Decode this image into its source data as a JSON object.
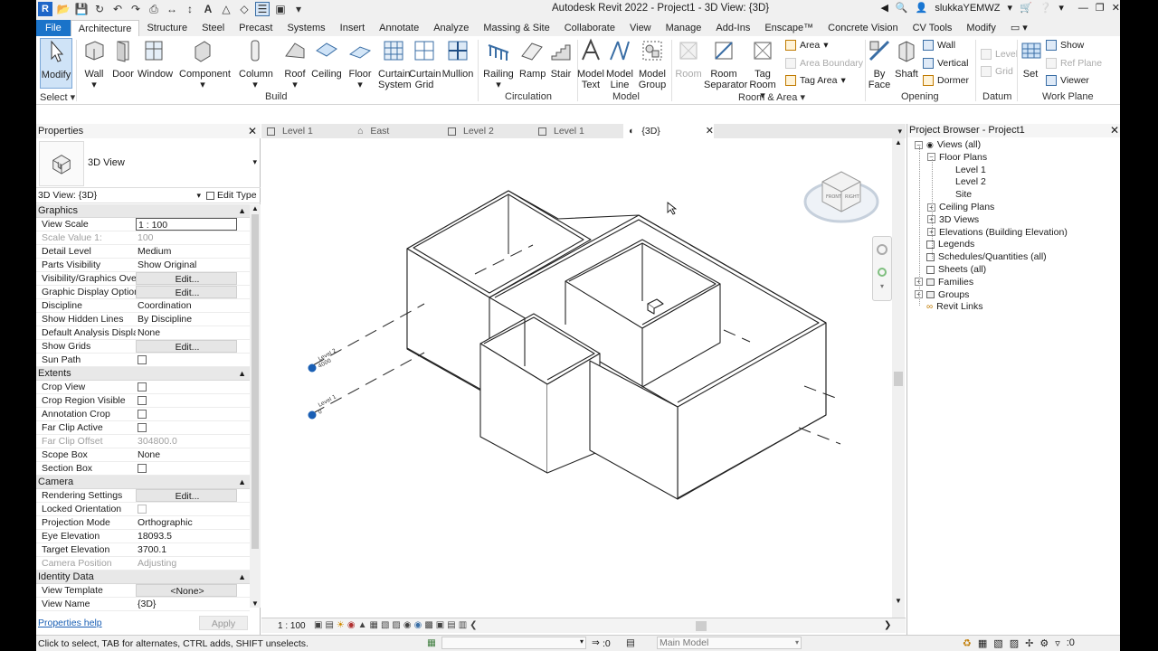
{
  "app": {
    "title": "Autodesk Revit 2022 - Project1 - 3D View: {3D}",
    "user": "slukkaYEMWZ"
  },
  "ribbon": {
    "tabs": [
      "File",
      "Architecture",
      "Structure",
      "Steel",
      "Precast",
      "Systems",
      "Insert",
      "Annotate",
      "Analyze",
      "Massing & Site",
      "Collaborate",
      "View",
      "Manage",
      "Add-Ins",
      "Enscape™",
      "Concrete Vision",
      "CV Tools",
      "Modify"
    ],
    "active_tab": "Architecture",
    "buttons": {
      "modify": "Modify",
      "wall": "Wall",
      "door": "Door",
      "window": "Window",
      "component": "Component",
      "column": "Column",
      "roof": "Roof",
      "ceiling": "Ceiling",
      "floor": "Floor",
      "curtain_system_1": "Curtain",
      "curtain_system_2": "System",
      "curtain_grid_1": "Curtain",
      "curtain_grid_2": "Grid",
      "mullion": "Mullion",
      "railing": "Railing",
      "ramp": "Ramp",
      "stair": "Stair",
      "model_text_1": "Model",
      "model_text_2": "Text",
      "model_line_1": "Model",
      "model_line_2": "Line",
      "model_group_1": "Model",
      "model_group_2": "Group",
      "room": "Room",
      "room_separator_1": "Room",
      "room_separator_2": "Separator",
      "tag_room_1": "Tag",
      "tag_room_2": "Room",
      "area": "Area",
      "area_boundary": "Area  Boundary",
      "tag_area": "Tag  Area",
      "by_face_1": "By",
      "by_face_2": "Face",
      "shaft": "Shaft",
      "wall_opening": "Wall",
      "vertical": "Vertical",
      "dormer": "Dormer",
      "level": "Level",
      "grid": "Grid",
      "set": "Set",
      "show": "Show",
      "ref_plane": "Ref  Plane",
      "viewer": "Viewer"
    },
    "panels": {
      "select": "Select",
      "build": "Build",
      "circulation": "Circulation",
      "model": "Model",
      "room_area": "Room & Area",
      "opening": "Opening",
      "datum": "Datum",
      "work_plane": "Work Plane"
    }
  },
  "properties": {
    "title": "Properties",
    "type_name": "3D View",
    "selector": "3D View: {3D}",
    "edit_type": "Edit Type",
    "groups": [
      {
        "name": "Graphics",
        "rows": [
          {
            "k": "View Scale",
            "v": "1 : 100",
            "kind": "input"
          },
          {
            "k": "Scale Value    1:",
            "v": "100",
            "kind": "dis"
          },
          {
            "k": "Detail Level",
            "v": "Medium",
            "kind": "text"
          },
          {
            "k": "Parts Visibility",
            "v": "Show Original",
            "kind": "text"
          },
          {
            "k": "Visibility/Graphics Over...",
            "v": "Edit...",
            "kind": "btn"
          },
          {
            "k": "Graphic Display Options",
            "v": "Edit...",
            "kind": "btn"
          },
          {
            "k": "Discipline",
            "v": "Coordination",
            "kind": "text"
          },
          {
            "k": "Show Hidden Lines",
            "v": "By Discipline",
            "kind": "text"
          },
          {
            "k": "Default Analysis Displa...",
            "v": "None",
            "kind": "text"
          },
          {
            "k": "Show Grids",
            "v": "Edit...",
            "kind": "btn"
          },
          {
            "k": "Sun Path",
            "v": "",
            "kind": "cb"
          }
        ]
      },
      {
        "name": "Extents",
        "rows": [
          {
            "k": "Crop View",
            "v": "",
            "kind": "cb"
          },
          {
            "k": "Crop Region Visible",
            "v": "",
            "kind": "cb"
          },
          {
            "k": "Annotation Crop",
            "v": "",
            "kind": "cb"
          },
          {
            "k": "Far Clip Active",
            "v": "",
            "kind": "cb"
          },
          {
            "k": "Far Clip Offset",
            "v": "304800.0",
            "kind": "dis"
          },
          {
            "k": "Scope Box",
            "v": "None",
            "kind": "text"
          },
          {
            "k": "Section Box",
            "v": "",
            "kind": "cb"
          }
        ]
      },
      {
        "name": "Camera",
        "rows": [
          {
            "k": "Rendering Settings",
            "v": "Edit...",
            "kind": "btn"
          },
          {
            "k": "Locked Orientation",
            "v": "",
            "kind": "cbdis"
          },
          {
            "k": "Projection Mode",
            "v": "Orthographic",
            "kind": "text"
          },
          {
            "k": "Eye Elevation",
            "v": "18093.5",
            "kind": "text"
          },
          {
            "k": "Target Elevation",
            "v": "3700.1",
            "kind": "text"
          },
          {
            "k": "Camera Position",
            "v": "Adjusting",
            "kind": "dis"
          }
        ]
      },
      {
        "name": "Identity Data",
        "rows": [
          {
            "k": "View Template",
            "v": "<None>",
            "kind": "btn"
          },
          {
            "k": "View Name",
            "v": "{3D}",
            "kind": "text"
          }
        ]
      }
    ],
    "help": "Properties help",
    "apply": "Apply"
  },
  "view_tabs": [
    {
      "label": "Level 1",
      "active": false
    },
    {
      "label": "East",
      "active": false
    },
    {
      "label": "Level 2",
      "active": false
    },
    {
      "label": "Level 1",
      "active": false
    },
    {
      "label": "{3D}",
      "active": true
    }
  ],
  "canvas": {
    "level2_label": "Level 2",
    "level2_elev": "4000",
    "level1_label": "Level 1",
    "level1_elev": "0",
    "viewcube_front": "FRONT",
    "viewcube_right": "RIGHT"
  },
  "view_control_bar": {
    "scale": "1 : 100"
  },
  "browser": {
    "title": "Project Browser - Project1",
    "nodes": [
      {
        "label": "Views (all)",
        "depth": 0,
        "exp": "-"
      },
      {
        "label": "Floor Plans",
        "depth": 1,
        "exp": "-"
      },
      {
        "label": "Level 1",
        "depth": 2,
        "exp": ""
      },
      {
        "label": "Level 2",
        "depth": 2,
        "exp": ""
      },
      {
        "label": "Site",
        "depth": 2,
        "exp": ""
      },
      {
        "label": "Ceiling Plans",
        "depth": 1,
        "exp": "+"
      },
      {
        "label": "3D Views",
        "depth": 1,
        "exp": "+"
      },
      {
        "label": "Elevations (Building Elevation)",
        "depth": 1,
        "exp": "+"
      },
      {
        "label": "Legends",
        "depth": 0,
        "exp": ""
      },
      {
        "label": "Schedules/Quantities (all)",
        "depth": 0,
        "exp": ""
      },
      {
        "label": "Sheets (all)",
        "depth": 0,
        "exp": ""
      },
      {
        "label": "Families",
        "depth": 0,
        "exp": "+"
      },
      {
        "label": "Groups",
        "depth": 0,
        "exp": "+"
      },
      {
        "label": "Revit Links",
        "depth": 0,
        "exp": ""
      }
    ]
  },
  "status": {
    "hint": "Click to select, TAB for alternates, CTRL adds, SHIFT unselects.",
    "count": ":0",
    "model": "Main Model",
    "filter": ":0"
  }
}
